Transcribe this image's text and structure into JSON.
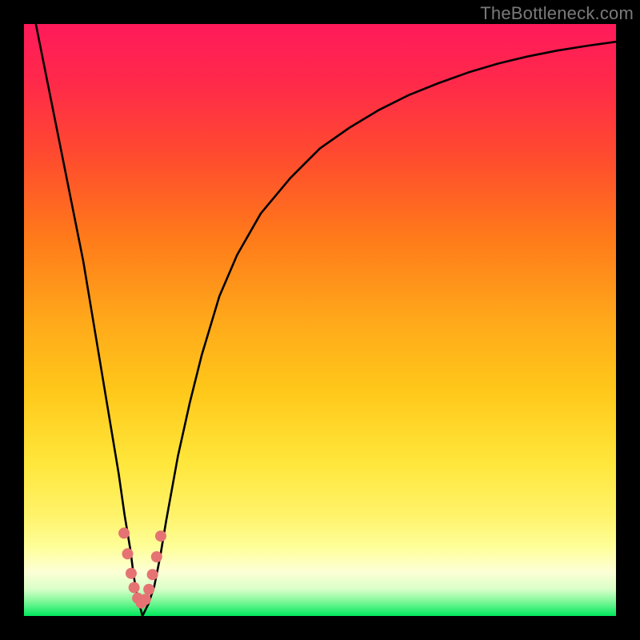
{
  "watermark": "TheBottleneck.com",
  "colors": {
    "black": "#000000",
    "magenta_top": "#ff1a5a",
    "red": "#ff3a2f",
    "orange": "#ff8a1a",
    "gold": "#ffc21a",
    "yellow": "#ffe63a",
    "pale_yellow": "#feff9a",
    "cream": "#fdffd6",
    "green": "#00e85c",
    "curve": "#000000",
    "dots": "#e57373"
  },
  "chart_data": {
    "type": "line",
    "title": "",
    "xlabel": "",
    "ylabel": "",
    "xlim": [
      0,
      100
    ],
    "ylim": [
      0,
      100
    ],
    "curve_samples": {
      "x": [
        0,
        2,
        4,
        6,
        8,
        10,
        12,
        14,
        16,
        17,
        18,
        18.5,
        19,
        19.5,
        20,
        21,
        22,
        23,
        24,
        26,
        28,
        30,
        33,
        36,
        40,
        45,
        50,
        55,
        60,
        65,
        70,
        75,
        80,
        85,
        90,
        95,
        100
      ],
      "y": [
        110,
        100,
        90,
        80,
        70,
        60,
        48,
        36,
        24,
        17,
        11,
        7,
        4,
        2,
        0,
        2,
        5,
        10,
        16,
        27,
        36,
        44,
        54,
        61,
        68,
        74,
        79,
        82.5,
        85.5,
        88,
        90,
        91.8,
        93.3,
        94.5,
        95.5,
        96.3,
        97
      ]
    },
    "dots": [
      {
        "x": 16.9,
        "y": 14.0
      },
      {
        "x": 17.5,
        "y": 10.5
      },
      {
        "x": 18.1,
        "y": 7.2
      },
      {
        "x": 18.6,
        "y": 4.8
      },
      {
        "x": 19.2,
        "y": 3.0
      },
      {
        "x": 19.8,
        "y": 2.2
      },
      {
        "x": 20.5,
        "y": 2.8
      },
      {
        "x": 21.1,
        "y": 4.5
      },
      {
        "x": 21.7,
        "y": 7.0
      },
      {
        "x": 22.4,
        "y": 10.0
      },
      {
        "x": 23.1,
        "y": 13.5
      }
    ]
  }
}
